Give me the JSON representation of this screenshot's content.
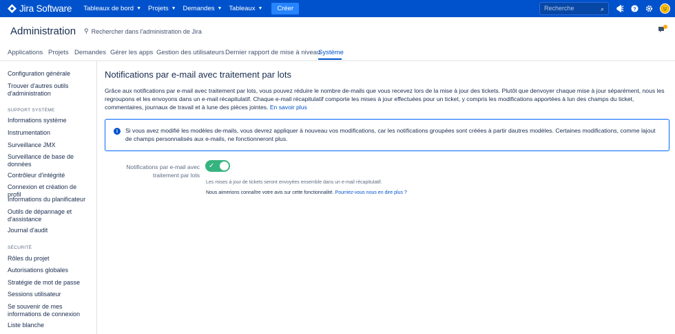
{
  "topbar": {
    "logo_text": "Jira Software",
    "nav": [
      {
        "label": "Tableaux de bord"
      },
      {
        "label": "Projets"
      },
      {
        "label": "Demandes"
      },
      {
        "label": "Tableaux"
      }
    ],
    "create_label": "Créer",
    "search_placeholder": "Recherche",
    "icons": [
      "notifications-icon",
      "help-icon",
      "settings-icon",
      "avatar"
    ]
  },
  "header": {
    "title": "Administration",
    "search_label": "Rechercher dans l'administration de Jira"
  },
  "tabs": [
    {
      "label": "Applications"
    },
    {
      "label": "Projets"
    },
    {
      "label": "Demandes"
    },
    {
      "label": "Gérer les apps"
    },
    {
      "label": "Gestion des utilisateurs"
    },
    {
      "label": "Dernier rapport de mise à niveau"
    },
    {
      "label": "Système",
      "active": true
    }
  ],
  "sidebar": {
    "items_top": [
      {
        "label": "Configuration générale"
      },
      {
        "label": "Trouver d'autres outils d'administration"
      }
    ],
    "section_support": "SUPPORT SYSTÈME",
    "items_support": [
      {
        "label": "Informations système"
      },
      {
        "label": "Instrumentation"
      },
      {
        "label": "Surveillance JMX"
      },
      {
        "label": "Surveillance de base de données"
      },
      {
        "label": "Contrôleur d'intégrité"
      },
      {
        "label": "Connexion et création de profil"
      },
      {
        "label": "Informations du planificateur"
      },
      {
        "label": "Outils de dépannage et d'assistance"
      },
      {
        "label": "Journal d'audit"
      }
    ],
    "section_security": "SÉCURITÉ",
    "items_security": [
      {
        "label": "Rôles du projet"
      },
      {
        "label": "Autorisations globales"
      },
      {
        "label": "Stratégie de mot de passe"
      },
      {
        "label": "Sessions utilisateur"
      },
      {
        "label": "Se souvenir de mes informations de connexion"
      },
      {
        "label": "Liste blanche"
      }
    ]
  },
  "main": {
    "title": "Notifications par e-mail avec traitement par lots",
    "intro": "Grâce aux notifications par e-mail avec traitement par lots, vous pouvez réduire le nombre de-mails que vous recevez lors de la mise à jour des tickets. Plutôt que denvoyer chaque mise à jour séparément, nous les regroupons et les envoyons dans un e-mail récapitulatif. Chaque e-mail récapitulatif comporte les mises à jour effectuées pour un ticket, y compris les modifications apportées à lun des champs du ticket, commentaires, journaux de travail et à lune des pièces jointes.",
    "learn_more": "En savoir plus",
    "info": "Si vous avez modifié les modèles de-mails, vous devrez appliquer à nouveau vos modifications, car les notifications groupées sont créées à partir dautres modèles. Certaines modifications, comme lajout de champs personnalisés aux e-mails, ne fonctionneront plus.",
    "field_label": "Notifications par e-mail avec traitement par lots",
    "toggle_on": true,
    "help_text": "Les mises à jour de tickets seront envoyées ensemble dans un e-mail récapitulatif.",
    "feedback_text": "Nous aimerions connaître votre avis sur cette fonctionnalité.",
    "feedback_link": "Pourriez-vous nous en dire plus ?"
  },
  "colors": {
    "brand": "#0052cc",
    "toggle_on": "#36b37e",
    "info_border": "#0065ff"
  }
}
